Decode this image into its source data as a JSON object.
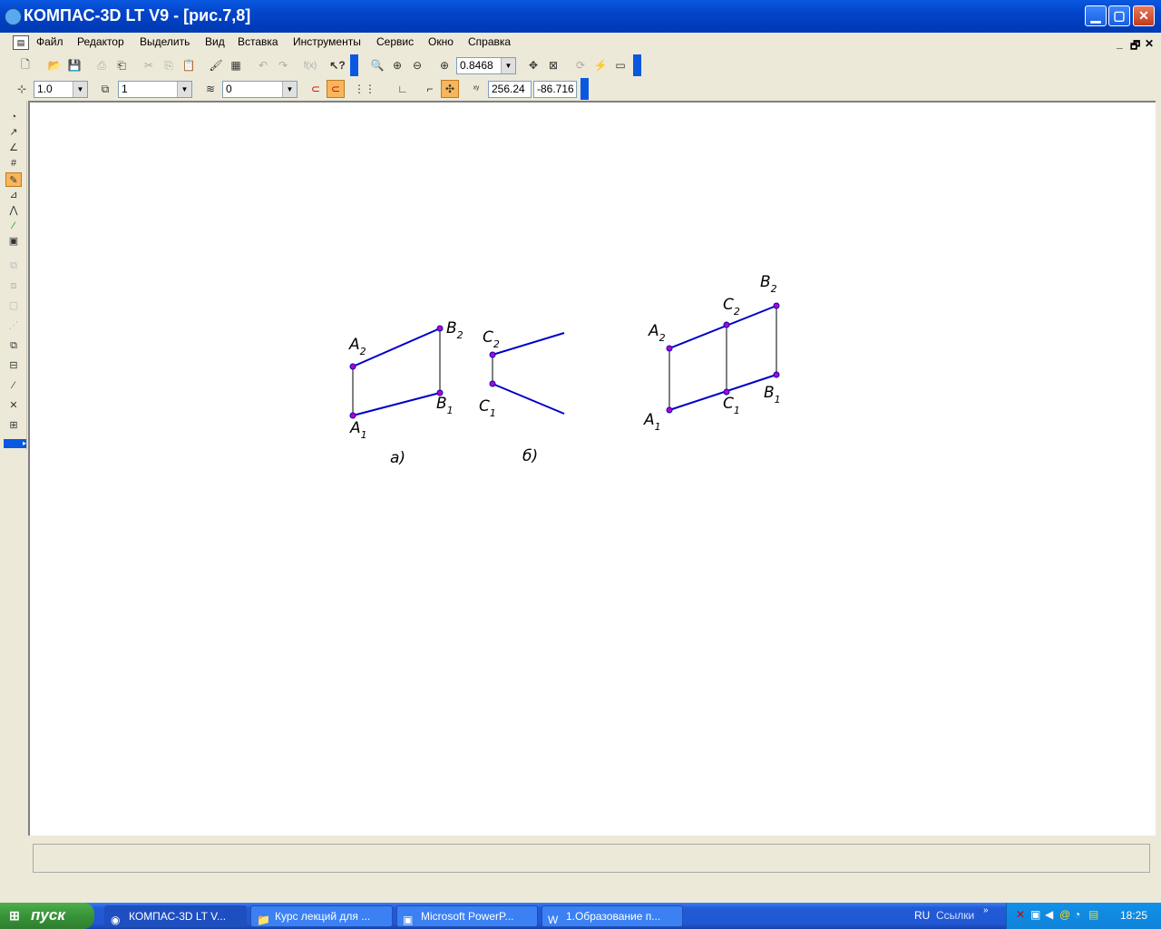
{
  "window": {
    "title": "КОМПАС-3D LT V9 - [рис.7,8]"
  },
  "menu": {
    "items": [
      "Файл",
      "Редактор",
      "Выделить",
      "Вид",
      "Вставка",
      "Инструменты",
      "Сервис",
      "Окно",
      "Справка"
    ]
  },
  "toolbar": {
    "zoom_value": "0.8468"
  },
  "current_params": {
    "line_step": "1.0",
    "style": "1",
    "layer": "0",
    "x_coord": "256.24",
    "y_coord": "-86.716"
  },
  "drawing": {
    "colors": {
      "line": "#0000c8",
      "point": "#c000c0",
      "link": "#000000"
    },
    "fig_a": {
      "caption": "а)",
      "labels": {
        "A2": [
          "A",
          "2"
        ],
        "B2": [
          "B",
          "2"
        ],
        "A1": [
          "A",
          "1"
        ],
        "B1": [
          "B",
          "1"
        ]
      }
    },
    "fig_b": {
      "caption": "б)",
      "labels": {
        "C2": [
          "C",
          "2"
        ],
        "C1": [
          "C",
          "1"
        ]
      }
    },
    "fig_c": {
      "labels": {
        "A2": [
          "A",
          "2"
        ],
        "C2": [
          "C",
          "2"
        ],
        "B2": [
          "B",
          "2"
        ],
        "A1": [
          "A",
          "1"
        ],
        "C1": [
          "C",
          "1"
        ],
        "B1": [
          "B",
          "1"
        ]
      }
    }
  },
  "taskbar": {
    "start": "пуск",
    "tasks": [
      "КОМПАС-3D LT V...",
      "Курс лекций для ...",
      "Microsoft PowerP...",
      "1.Образование п..."
    ],
    "tray_lang": "RU",
    "tray_links": "Ссылки",
    "clock": "18:25"
  }
}
